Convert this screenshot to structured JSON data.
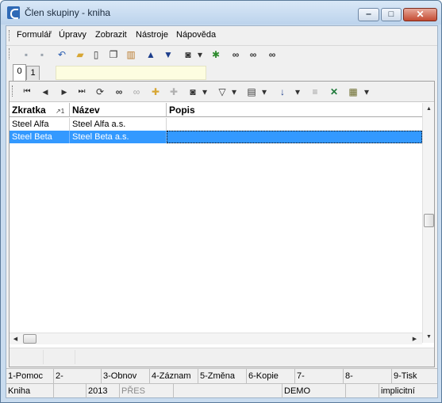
{
  "window": {
    "title": "Člen skupiny - kniha",
    "controls": {
      "minimize": "‒",
      "maximize": "□",
      "close": "✕"
    }
  },
  "menu": [
    {
      "label": "Formulář"
    },
    {
      "label": "Úpravy"
    },
    {
      "label": "Zobrazit"
    },
    {
      "label": "Nástroje"
    },
    {
      "label": "Nápověda"
    }
  ],
  "toolbar_main": [
    {
      "icon": "save-icon",
      "glyph": "▪"
    },
    {
      "icon": "save-close-icon",
      "glyph": "▪"
    },
    {
      "icon": "undo-icon",
      "glyph": "↶"
    },
    {
      "icon": "open-folder-icon",
      "glyph": "▰"
    },
    {
      "icon": "new-document-icon",
      "glyph": "▯"
    },
    {
      "icon": "copy-icon",
      "glyph": "❐"
    },
    {
      "icon": "book-icon",
      "glyph": "▥"
    },
    {
      "icon": "arrow-up-icon",
      "glyph": "▲"
    },
    {
      "icon": "arrow-down-icon",
      "glyph": "▼"
    },
    {
      "icon": "camera-icon",
      "glyph": "◙"
    },
    {
      "icon": "dropdown-arrow-icon",
      "glyph": "▾"
    },
    {
      "icon": "filter-binoculars-icon",
      "glyph": "✱"
    },
    {
      "icon": "binoculars-icon",
      "glyph": "∞"
    },
    {
      "icon": "binoculars-next-icon",
      "glyph": "∞"
    },
    {
      "icon": "binoculars-previous-icon",
      "glyph": "∞"
    }
  ],
  "tabs": [
    {
      "label": "0",
      "active": true
    },
    {
      "label": "1",
      "active": false
    }
  ],
  "toolbar_grid": [
    {
      "icon": "first-record-icon",
      "glyph": "⏮"
    },
    {
      "icon": "previous-record-icon",
      "glyph": "◀"
    },
    {
      "icon": "next-record-icon",
      "glyph": "▶"
    },
    {
      "icon": "last-record-icon",
      "glyph": "⏭"
    },
    {
      "icon": "refresh-icon",
      "glyph": "⟳"
    },
    {
      "icon": "find-icon",
      "glyph": "∞"
    },
    {
      "icon": "find-disabled-icon",
      "glyph": "∞"
    },
    {
      "icon": "add-bookmark-icon",
      "glyph": "✚"
    },
    {
      "icon": "bookmark-disabled-icon",
      "glyph": "✚"
    },
    {
      "icon": "camera-icon",
      "glyph": "◙"
    },
    {
      "icon": "dropdown-arrow-icon",
      "glyph": "▾"
    },
    {
      "icon": "filter-icon",
      "glyph": "▽"
    },
    {
      "icon": "dropdown-arrow-icon",
      "glyph": "▾"
    },
    {
      "icon": "columns-icon",
      "glyph": "▤"
    },
    {
      "icon": "dropdown-arrow-icon",
      "glyph": "▾"
    },
    {
      "icon": "sort-az-icon",
      "glyph": "↓"
    },
    {
      "icon": "dropdown-arrow-icon",
      "glyph": "▾"
    },
    {
      "icon": "tree-list-icon",
      "glyph": "≡"
    },
    {
      "icon": "export-excel-icon",
      "glyph": "✕"
    },
    {
      "icon": "report-icon",
      "glyph": "▦"
    },
    {
      "icon": "dropdown-arrow-icon",
      "glyph": "▾"
    }
  ],
  "grid": {
    "columns": [
      {
        "label": "Zkratka",
        "sort": "↗1"
      },
      {
        "label": "Název"
      },
      {
        "label": "Popis"
      }
    ],
    "rows": [
      {
        "zkratka": "Steel Alfa",
        "nazev": "Steel Alfa a.s.",
        "popis": "",
        "selected": false
      },
      {
        "zkratka": "Steel Beta",
        "nazev": "Steel Beta a.s.",
        "popis": "",
        "selected": true
      }
    ]
  },
  "function_keys": [
    {
      "label": "1-Pomoc"
    },
    {
      "label": "2-"
    },
    {
      "label": "3-Obnov"
    },
    {
      "label": "4-Záznam"
    },
    {
      "label": "5-Změna"
    },
    {
      "label": "6-Kopie"
    },
    {
      "label": "7-"
    },
    {
      "label": "8-"
    },
    {
      "label": "9-Tisk"
    }
  ],
  "status_bar": [
    {
      "label": "Kniha"
    },
    {
      "label": ""
    },
    {
      "label": "2013"
    },
    {
      "label": "PŘES"
    },
    {
      "label": ""
    },
    {
      "label": "DEMO"
    },
    {
      "label": ""
    },
    {
      "label": "implicitní"
    }
  ]
}
